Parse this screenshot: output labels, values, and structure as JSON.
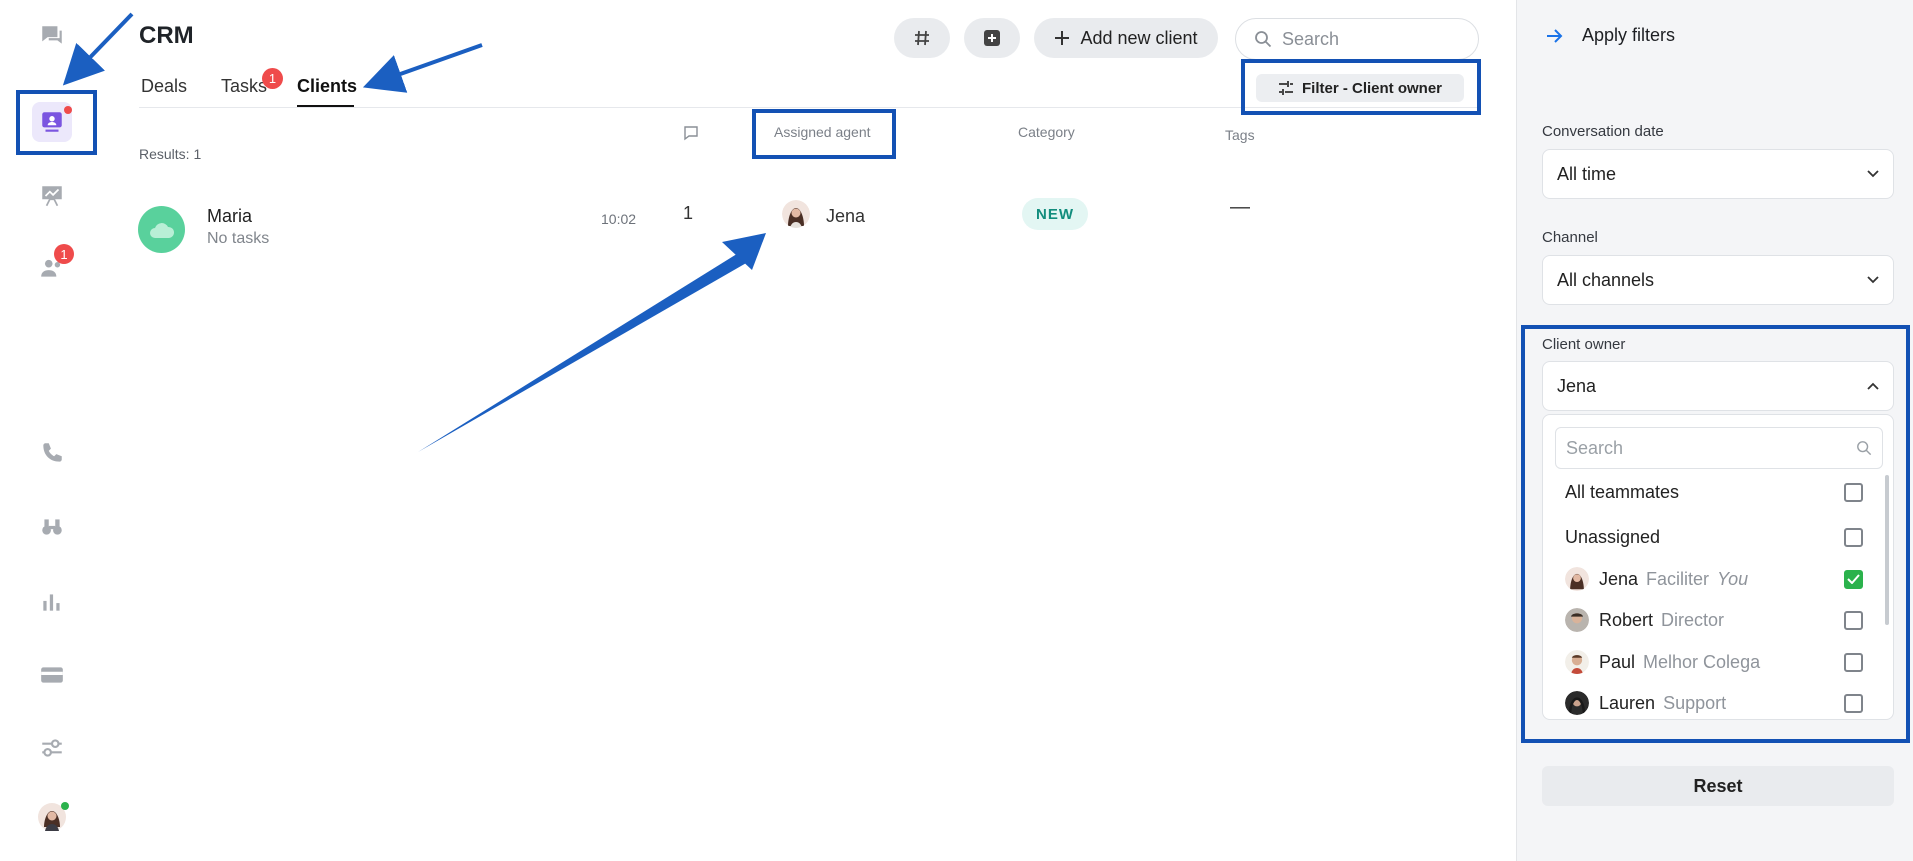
{
  "app": {
    "title": "CRM"
  },
  "tabs": [
    {
      "label": "Deals"
    },
    {
      "label": "Tasks",
      "badge": "1"
    },
    {
      "label": "Clients",
      "active": true
    }
  ],
  "toolbar": {
    "hash_icon": "hash-icon",
    "plus_box_icon": "plus-square-icon",
    "add_label": "Add new client",
    "search_placeholder": "Search",
    "filter_chip": "Filter - Client owner"
  },
  "sidebar": {
    "items": [
      {
        "icon": "chat-icon"
      },
      {
        "icon": "crm-icon",
        "active": true
      },
      {
        "icon": "board-icon"
      },
      {
        "icon": "people-icon",
        "badge": "1"
      },
      {
        "icon": "phone-icon"
      },
      {
        "icon": "binoculars-icon"
      },
      {
        "icon": "bar-chart-icon"
      },
      {
        "icon": "card-icon"
      },
      {
        "icon": "sliders-icon"
      },
      {
        "icon": "avatar"
      }
    ]
  },
  "table": {
    "results": "Results: 1",
    "headers": {
      "assigned": "Assigned agent",
      "category": "Category",
      "tags": "Tags"
    },
    "rows": [
      {
        "name": "Maria",
        "sub": "No tasks",
        "time": "10:02",
        "count": "1",
        "agent": "Jena",
        "category": "NEW",
        "tags": "—"
      }
    ]
  },
  "filters": {
    "title": "Apply filters",
    "conversation_date": {
      "label": "Conversation date",
      "value": "All time"
    },
    "channel": {
      "label": "Channel",
      "value": "All channels"
    },
    "client_owner": {
      "label": "Client owner",
      "value": "Jena"
    },
    "dropdown": {
      "search_placeholder": "Search",
      "options": [
        {
          "name": "All teammates",
          "role": "",
          "checked": false
        },
        {
          "name": "Unassigned",
          "role": "",
          "checked": false
        },
        {
          "name": "Jena",
          "role": "Faciliter",
          "you": "You",
          "checked": true
        },
        {
          "name": "Robert",
          "role": "Director",
          "checked": false
        },
        {
          "name": "Paul",
          "role": "Melhor Colega",
          "checked": false
        },
        {
          "name": "Lauren",
          "role": "Support",
          "checked": false
        }
      ]
    },
    "reset_label": "Reset"
  },
  "colors": {
    "accent": "#1351b4",
    "badge": "#ef4b4b",
    "check": "#2bb24c",
    "new_badge_bg": "#e3f6f3"
  }
}
